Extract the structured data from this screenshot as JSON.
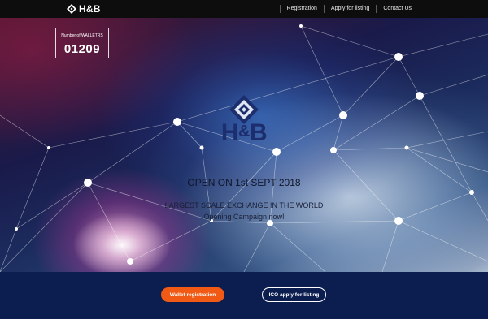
{
  "header": {
    "logo_text": "H&B",
    "nav": [
      "Registration",
      "Apply for listing",
      "Contact Us"
    ]
  },
  "counter": {
    "label": "Number of WALLETRS",
    "value": "01209"
  },
  "hero": {
    "logo_text_h": "H",
    "logo_text_amp": "&",
    "logo_text_b": "B",
    "open_text": "OPEN ON 1st SEPT 2018",
    "tagline1": "LARGEST SCALE EXCHANGE IN THE WORLD",
    "tagline2": "Opening Campaign now!"
  },
  "footer": {
    "wallet_button": "Wallet registration",
    "ico_button": "ICO apply for listing"
  },
  "colors": {
    "topbar": "#0d0d0d",
    "footer": "#0c1e4f",
    "accent_orange": "#f05a14",
    "logo_navy": "#1d2e6e"
  },
  "icons": {
    "header_logo": "hb-diamond-logo-icon",
    "center_logo": "hb-diamond-logo-icon"
  }
}
